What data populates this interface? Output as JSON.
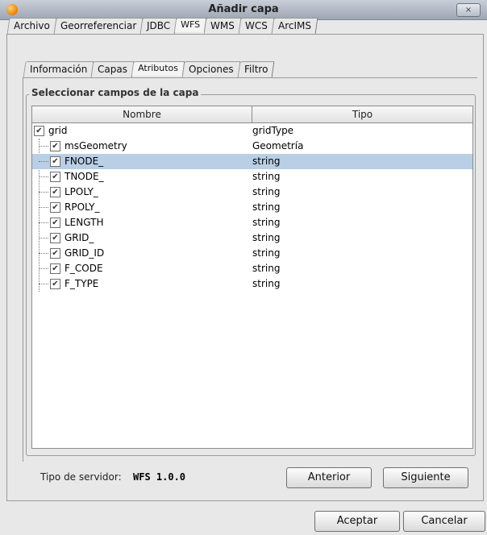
{
  "window": {
    "title": "Añadir capa",
    "close_label": "×"
  },
  "top_tabs": [
    "Archivo",
    "Georreferenciar",
    "JDBC",
    "WFS",
    "WMS",
    "WCS",
    "ArcIMS"
  ],
  "top_tabs_active": "WFS",
  "sub_tabs": [
    "Información",
    "Capas",
    "Atributos",
    "Opciones",
    "Filtro"
  ],
  "sub_tabs_active": "Atributos",
  "fieldset_title": "Seleccionar campos de la capa",
  "table": {
    "col_name": "Nombre",
    "col_type": "Tipo",
    "rows": [
      {
        "name": "grid",
        "type": "gridType",
        "checked": true,
        "level": 0,
        "selected": false
      },
      {
        "name": "msGeometry",
        "type": "Geometría",
        "checked": true,
        "level": 1,
        "selected": false
      },
      {
        "name": "FNODE_",
        "type": "string",
        "checked": true,
        "level": 1,
        "selected": true
      },
      {
        "name": "TNODE_",
        "type": "string",
        "checked": true,
        "level": 1,
        "selected": false
      },
      {
        "name": "LPOLY_",
        "type": "string",
        "checked": true,
        "level": 1,
        "selected": false
      },
      {
        "name": "RPOLY_",
        "type": "string",
        "checked": true,
        "level": 1,
        "selected": false
      },
      {
        "name": "LENGTH",
        "type": "string",
        "checked": true,
        "level": 1,
        "selected": false
      },
      {
        "name": "GRID_",
        "type": "string",
        "checked": true,
        "level": 1,
        "selected": false
      },
      {
        "name": "GRID_ID",
        "type": "string",
        "checked": true,
        "level": 1,
        "selected": false
      },
      {
        "name": "F_CODE",
        "type": "string",
        "checked": true,
        "level": 1,
        "selected": false
      },
      {
        "name": "F_TYPE",
        "type": "string",
        "checked": true,
        "level": 1,
        "selected": false
      }
    ]
  },
  "server": {
    "label": "Tipo de servidor:",
    "value": "WFS 1.0.0"
  },
  "buttons": {
    "previous": "Anterior",
    "next": "Siguiente",
    "accept": "Aceptar",
    "cancel": "Cancelar"
  },
  "colors": {
    "selection": "#b8cfe5",
    "window_bg": "#e8e8e8"
  },
  "icons": {
    "app": "app-logo-icon",
    "check": "check-icon"
  }
}
